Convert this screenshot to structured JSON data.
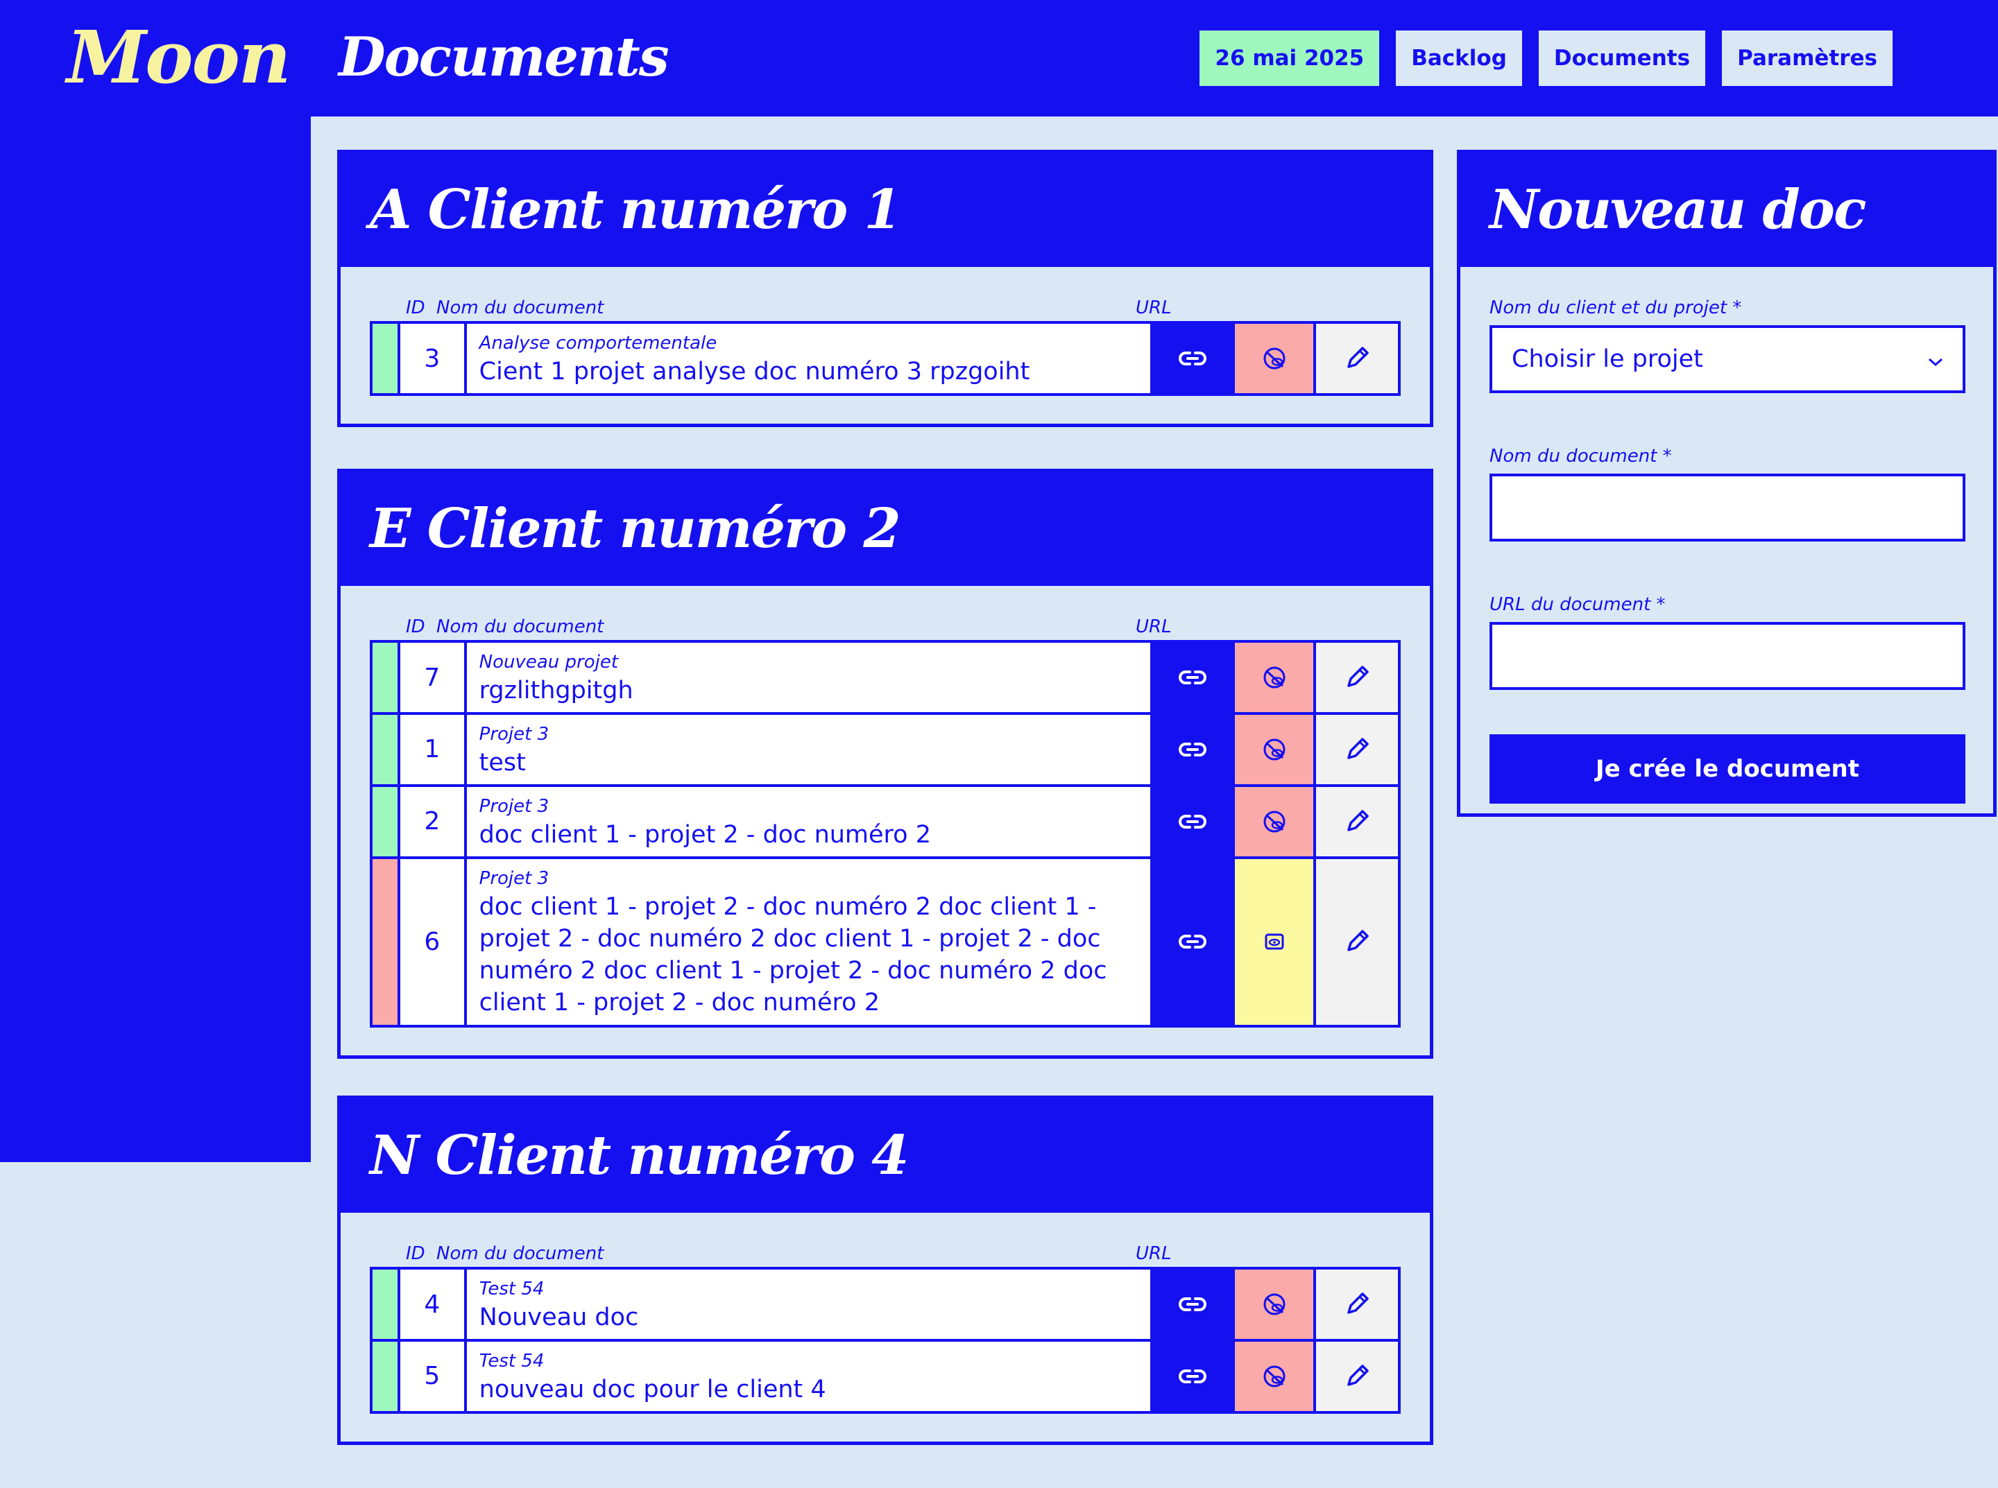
{
  "app": {
    "logo": "Moon",
    "page_title": "Documents"
  },
  "nav": {
    "date": "26 mai 2025",
    "items": [
      "Backlog",
      "Documents",
      "Paramètres"
    ]
  },
  "table_headers": {
    "id": "ID",
    "name": "Nom du document",
    "url": "URL"
  },
  "clients": [
    {
      "heading": "A Client numéro 1",
      "docs": [
        {
          "id": "3",
          "status": "ok",
          "visibility": "hidden",
          "project": "Analyse comportementale",
          "title": "Cient 1 projet analyse doc numéro 3 rpzgoiht"
        }
      ]
    },
    {
      "heading": "E Client numéro 2",
      "docs": [
        {
          "id": "7",
          "status": "ok",
          "visibility": "hidden",
          "project": "Nouveau projet",
          "title": "rgzlithgpitgh"
        },
        {
          "id": "1",
          "status": "ok",
          "visibility": "hidden",
          "project": "Projet 3",
          "title": "test"
        },
        {
          "id": "2",
          "status": "ok",
          "visibility": "hidden",
          "project": "Projet 3",
          "title": "doc client 1 - projet 2 - doc numéro 2"
        },
        {
          "id": "6",
          "status": "bad",
          "visibility": "visible",
          "project": "Projet 3",
          "title": "doc client 1 - projet 2 - doc numéro 2 doc client 1 - projet 2 - doc numéro 2 doc client 1 - projet 2 - doc numéro 2 doc client 1 - projet 2 - doc numéro 2 doc client 1 - projet 2 - doc numéro 2"
        }
      ]
    },
    {
      "heading": "N Client numéro 4",
      "docs": [
        {
          "id": "4",
          "status": "ok",
          "visibility": "hidden",
          "project": "Test 54",
          "title": "Nouveau doc"
        },
        {
          "id": "5",
          "status": "ok",
          "visibility": "hidden",
          "project": "Test 54",
          "title": "nouveau doc pour le client 4"
        }
      ]
    }
  ],
  "form": {
    "heading": "Nouveau doc",
    "project_label": "Nom du client et du projet *",
    "project_value": "Choisir le projet",
    "name_label": "Nom du document *",
    "name_value": "",
    "url_label": "URL du document *",
    "url_value": "",
    "submit_label": "Je crée le document"
  },
  "icons": {
    "url": "link-icon",
    "hidden": "eye-off-icon",
    "visible": "eye-icon",
    "edit": "pencil-icon",
    "select": "chevron-down-icon"
  },
  "colors": {
    "primary": "#1510f0",
    "background": "#dae8f5",
    "logo": "#f7f2a0",
    "status_ok": "#9ef7bd",
    "status_bad": "#fbaaaa",
    "visible": "#fbf8a0"
  }
}
